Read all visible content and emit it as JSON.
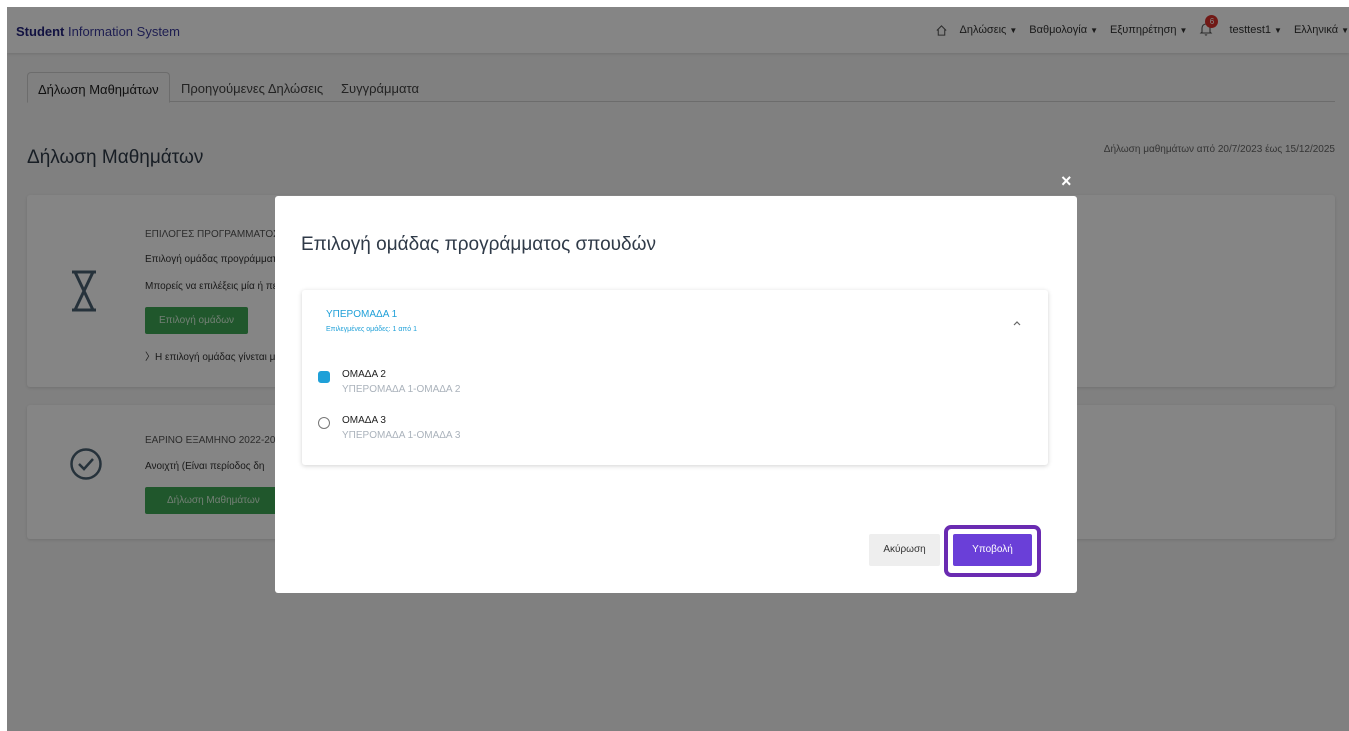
{
  "app": {
    "brand_bold": "Student",
    "brand_rest": " Information System"
  },
  "topnav": {
    "home_icon": "home-icon",
    "declarations": "Δηλώσεις",
    "grading": "Βαθμολογία",
    "service": "Εξυπηρέτηση",
    "notifications_count": "6",
    "user": "testtest1",
    "language": "Ελληνικά"
  },
  "tabs": [
    {
      "label": "Δήλωση Μαθημάτων",
      "active": true
    },
    {
      "label": "Προηγούμενες Δηλώσεις",
      "active": false
    },
    {
      "label": "Συγγράμματα",
      "active": false
    }
  ],
  "page": {
    "title": "Δήλωση Μαθημάτων",
    "period": "Δήλωση μαθημάτων από 20/7/2023 έως 15/12/2025"
  },
  "card1": {
    "icon": "hourglass-icon",
    "kicker": "ΕΠΙΛΟΓΕΣ ΠΡΟΓΡΑΜΜΑΤΟΣ Σ",
    "line1": "Επιλογή ομάδας προγράμματ",
    "line2": "Μπορείς να επιλέξεις μία ή πε",
    "button": "Επιλογή ομάδων",
    "note": "Η επιλογή ομάδας γίνεται μ"
  },
  "card2": {
    "icon": "check-circle-icon",
    "kicker": "ΕΑΡΙΝΟ ΕΞΑΜΗΝΟ 2022-20",
    "line1": "Ανοιχτή (Είναι περίοδος δη",
    "button": "Δήλωση Μαθημάτων"
  },
  "modal": {
    "close": "×",
    "title": "Επιλογή ομάδας προγράμματος σπουδών",
    "group": {
      "title": "ΥΠΕΡΟΜΑΔΑ 1",
      "selected": "Επιλεγμένες ομάδες: 1 από 1"
    },
    "options": [
      {
        "label": "ΟΜΑΔΑ 2",
        "sub": "ΥΠΕΡΟΜΑΔΑ 1-ΟΜΑΔΑ 2",
        "checked": true
      },
      {
        "label": "ΟΜΑΔΑ 3",
        "sub": "ΥΠΕΡΟΜΑΔΑ 1-ΟΜΑΔΑ 3",
        "checked": false
      }
    ],
    "cancel": "Ακύρωση",
    "submit": "Υποβολή"
  },
  "colors": {
    "accent_blue": "#1fa0d8",
    "submit_purple": "#6a3fd8",
    "highlight_ring": "#6a2bb1",
    "green_button": "#3fa855"
  }
}
